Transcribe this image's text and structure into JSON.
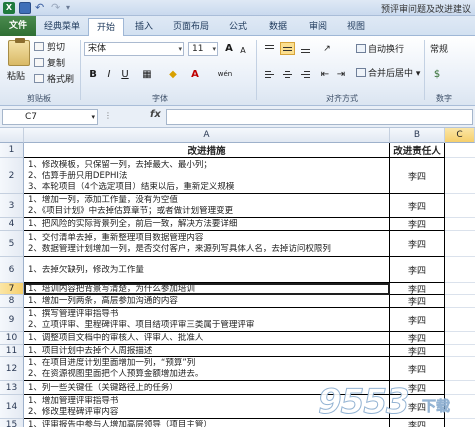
{
  "window": {
    "title": "预评审问题及改进建议"
  },
  "tabs": [
    {
      "label": "文件"
    },
    {
      "label": "经典菜单"
    },
    {
      "label": "开始"
    },
    {
      "label": "插入"
    },
    {
      "label": "页面布局"
    },
    {
      "label": "公式"
    },
    {
      "label": "数据"
    },
    {
      "label": "审阅"
    },
    {
      "label": "视图"
    }
  ],
  "active_tab": "开始",
  "ribbon": {
    "clipboard": {
      "paste": "粘贴",
      "cut": "剪切",
      "copy": "复制",
      "format_painter": "格式刷",
      "group": "剪贴板"
    },
    "font": {
      "name": "宋体",
      "size": "11",
      "group": "字体",
      "bold": "B",
      "italic": "I",
      "underline": "U",
      "grow": "A",
      "shrink": "A",
      "wen": "wén"
    },
    "alignment": {
      "wrap": "自动换行",
      "merge": "合并后居中",
      "group": "对齐方式"
    },
    "number": {
      "format": "常规",
      "group": "数字"
    }
  },
  "formula_bar": {
    "cell_ref": "C7",
    "fx": "fx",
    "value": ""
  },
  "columns": {
    "A": "A",
    "B": "B",
    "C": "C"
  },
  "rows": [
    {
      "num": "1",
      "lines": [
        "改进措施"
      ],
      "owner": "改进责任人",
      "header": true
    },
    {
      "num": "2",
      "lines": [
        "1、修改模板，只保留一列，去掉最大、最小列；",
        "2、估算手册只用DEPHI法",
        "3、本轮项目（4个选定项目）结束以后，重新定义规模"
      ],
      "owner": "李四"
    },
    {
      "num": "3",
      "lines": [
        "1、增加一列，添加工作量，没有为空值",
        "2、《项目计划》中去掉估算章节；或者做计划管理变更"
      ],
      "owner": "李四"
    },
    {
      "num": "4",
      "lines": [
        "1、把风险的实际背景列全，前后一致，解决方法要详细"
      ],
      "owner": "李四"
    },
    {
      "num": "5",
      "lines": [
        "1、交付清单去掉，重新整理项目数据管理内容",
        "2、数据管理计划增加一列，是否交付客户，来源列写具体人名，去掉访问权限列"
      ],
      "owner": "李四"
    },
    {
      "num": "6",
      "lines": [
        "1、去掉欠缺列，修改为工作量"
      ],
      "owner": "李四"
    },
    {
      "num": "7",
      "lines": [
        "1、培训内容把背景写清楚，为什么参加培训"
      ],
      "owner": "李四",
      "selected": true
    },
    {
      "num": "8",
      "lines": [
        "1、增加一列两条，高层参加沟通的内容"
      ],
      "owner": "李四"
    },
    {
      "num": "9",
      "lines": [
        "1、撰写管理评审指导书",
        "2、立项评审、里程碑评审、项目结项评审三类属于管理评审"
      ],
      "owner": "李四"
    },
    {
      "num": "10",
      "lines": [
        "1、调整项目文档中的审核人、评审人、批准人"
      ],
      "owner": "李四"
    },
    {
      "num": "11",
      "lines": [
        "1、项目计划中去掉个人周报描述"
      ],
      "owner": "李四"
    },
    {
      "num": "12",
      "lines": [
        "1、在项目进度计划里面增加一列，“预算”列",
        "2、在资源视图里面把个人预算金额增加进去。"
      ],
      "owner": "李四"
    },
    {
      "num": "13",
      "lines": [
        "1、列一些关键任（关键路径上的任务）"
      ],
      "owner": "李四"
    },
    {
      "num": "14",
      "lines": [
        "1、增加管理评审指导书",
        "2、修改里程碑评审内容"
      ],
      "owner": "李四"
    },
    {
      "num": "15",
      "lines": [
        "1、评审报告中参与人增加高层领导（项目主管）"
      ],
      "owner": "李四"
    }
  ],
  "watermark": {
    "logo": "9553",
    "sub": "下载"
  }
}
